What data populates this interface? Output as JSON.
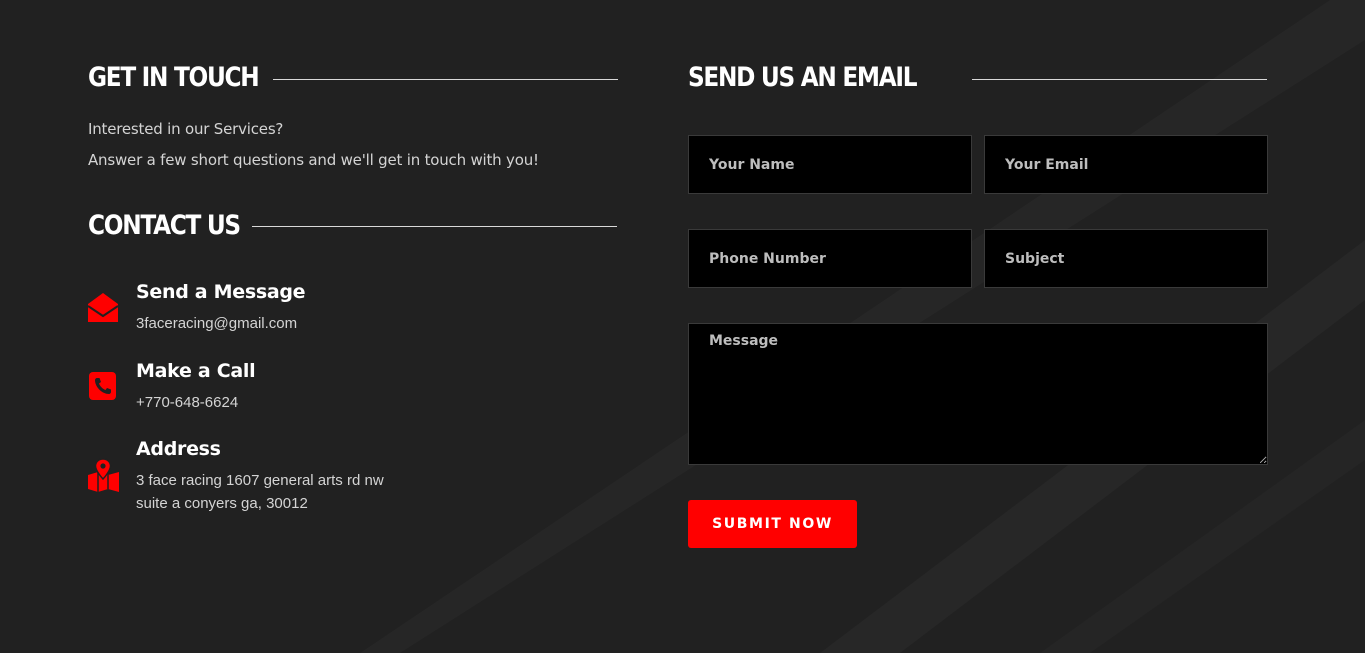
{
  "colors": {
    "background": "#212121",
    "accent": "#ff0000",
    "field_background": "#000000",
    "heading": "#ffffff",
    "body_text": "#d4d4d4"
  },
  "get_in_touch": {
    "heading": "GET IN TOUCH",
    "line1": "Interested in our Services?",
    "line2": "Answer a few short questions and we'll get in touch with you!"
  },
  "contact_us": {
    "heading": "CONTACT US",
    "items": [
      {
        "icon": "envelope-icon",
        "title": "Send a Message",
        "detail": "3faceracing@gmail.com"
      },
      {
        "icon": "phone-icon",
        "title": "Make a Call",
        "detail": "+770-648-6624"
      },
      {
        "icon": "map-pin-icon",
        "title": "Address",
        "detail_line1": "3 face racing 1607 general arts rd nw",
        "detail_line2": "suite a conyers ga, 30012"
      }
    ]
  },
  "email_form": {
    "heading": "SEND US AN EMAIL",
    "name_placeholder": "Your Name",
    "email_placeholder": "Your Email",
    "phone_placeholder": "Phone Number",
    "subject_placeholder": "Subject",
    "message_placeholder": "Message",
    "submit_label": "SUBMIT NOW"
  }
}
